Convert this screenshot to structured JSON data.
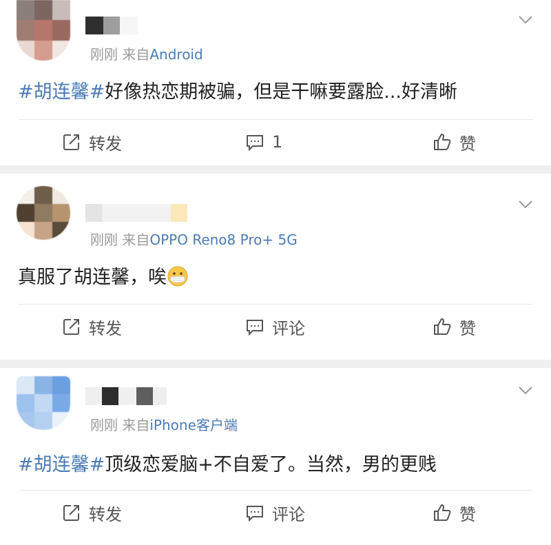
{
  "posts": [
    {
      "meta": {
        "time": "刚刚",
        "from": "来自",
        "source": "Android"
      },
      "content": {
        "hashtag": "#胡连馨#",
        "text": "好像热恋期被骗，但是干嘛要露脸...好清晰"
      },
      "actions": {
        "repost": "转发",
        "comment": "1",
        "like": "赞"
      }
    },
    {
      "meta": {
        "time": "刚刚",
        "from": "来自",
        "source": "OPPO Reno8 Pro+ 5G"
      },
      "content": {
        "text": "真服了胡连馨，唉",
        "emoji": "mask-face-emoji"
      },
      "actions": {
        "repost": "转发",
        "comment": "评论",
        "like": "赞"
      }
    },
    {
      "meta": {
        "time": "刚刚",
        "from": "来自",
        "source": "iPhone客户端"
      },
      "content": {
        "hashtag": "#胡连馨#",
        "text": "顶级恋爱脑+不自爱了。当然，男的更贱"
      },
      "actions": {
        "repost": "转发",
        "comment": "评论",
        "like": "赞"
      }
    }
  ],
  "colors": {
    "link": "#4a7bb7",
    "meta": "#9a9a9a",
    "separator": "#f0f0f0"
  },
  "icons": [
    "repost-icon",
    "comment-icon",
    "like-icon",
    "chevron-down-icon",
    "mask-face-emoji"
  ]
}
